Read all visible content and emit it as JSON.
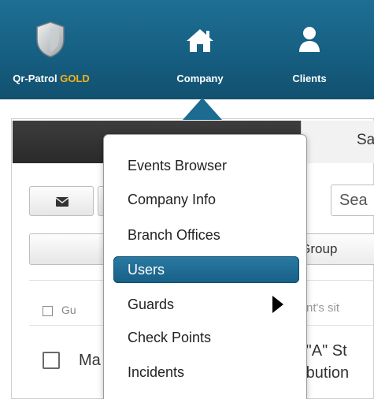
{
  "nav": {
    "brand_prefix": "Qr-Patrol",
    "brand_suffix": "GOLD",
    "items": [
      {
        "label": "Company",
        "icon": "home-icon"
      },
      {
        "label": "Clients",
        "icon": "user-icon"
      }
    ]
  },
  "page": {
    "tab_label": "Sa",
    "search_placeholder": "Sea",
    "group_label": "d Group",
    "header_cols": {
      "guard": "Gu",
      "site": "lient's sit"
    },
    "row": {
      "name": "Ma",
      "site_line1": "e \"A\" St",
      "site_line2": "tribution"
    }
  },
  "menu": {
    "items": [
      {
        "label": "Events Browser",
        "active": false,
        "has_submenu": false
      },
      {
        "label": "Company Info",
        "active": false,
        "has_submenu": false
      },
      {
        "label": "Branch Offices",
        "active": false,
        "has_submenu": false
      },
      {
        "label": "Users",
        "active": true,
        "has_submenu": false
      },
      {
        "label": "Guards",
        "active": false,
        "has_submenu": true
      },
      {
        "label": "Check Points",
        "active": false,
        "has_submenu": false
      },
      {
        "label": "Incidents",
        "active": false,
        "has_submenu": false
      }
    ]
  },
  "colors": {
    "nav_bg": "#1a6a8f",
    "brand_gold": "#f0b21b",
    "menu_active": "#1e6a93"
  }
}
